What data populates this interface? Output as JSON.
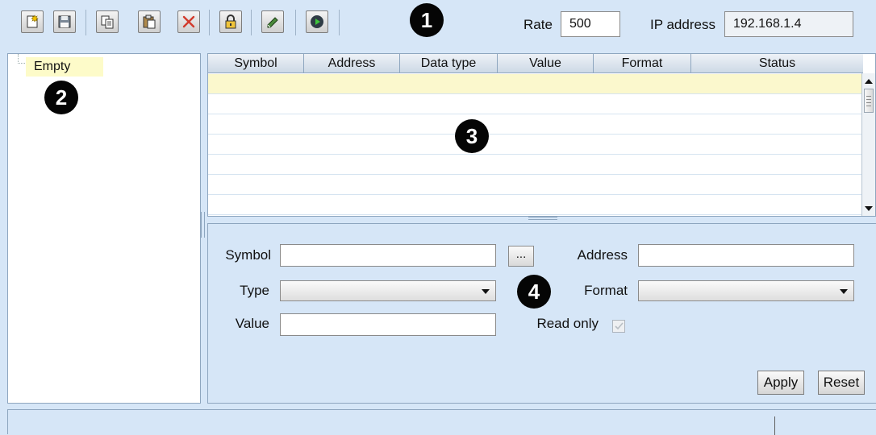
{
  "toolbar": {
    "buttons": [
      {
        "name": "new-icon"
      },
      {
        "name": "save-icon"
      },
      {
        "name": "copy-icon"
      },
      {
        "name": "paste-icon"
      },
      {
        "name": "delete-icon"
      },
      {
        "name": "lock-icon"
      },
      {
        "name": "write-icon"
      },
      {
        "name": "run-icon"
      }
    ],
    "rate_label": "Rate",
    "rate_value": "500",
    "ip_label": "IP address",
    "ip_value": "192.168.1.4"
  },
  "callouts": [
    "1",
    "2",
    "3",
    "4"
  ],
  "tree": {
    "items": [
      {
        "label": "Empty"
      }
    ]
  },
  "table": {
    "columns": [
      "Symbol",
      "Address",
      "Data type",
      "Value",
      "Format",
      "Status"
    ],
    "rows": []
  },
  "form": {
    "symbol_label": "Symbol",
    "symbol_value": "",
    "browse_label": "...",
    "address_label": "Address",
    "address_value": "",
    "type_label": "Type",
    "type_value": "",
    "format_label": "Format",
    "format_value": "",
    "value_label": "Value",
    "value_value": "",
    "readonly_label": "Read only",
    "readonly_checked": true,
    "apply_label": "Apply",
    "reset_label": "Reset"
  },
  "status_bar": {
    "text": ""
  },
  "colors": {
    "background": "#d6e6f7",
    "selected_row": "#fbf8cd",
    "border": "#8ea6bf"
  }
}
